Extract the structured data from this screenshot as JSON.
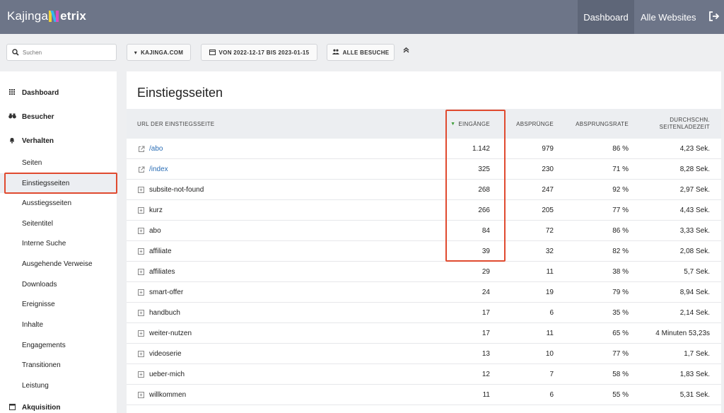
{
  "app": {
    "logo_prefix": "Kajinga",
    "logo_suffix": "etrix",
    "nav": {
      "dashboard": "Dashboard",
      "all_sites": "Alle Websites"
    }
  },
  "filters": {
    "search_placeholder": "Suchen",
    "site": "KAJINGA.COM",
    "date_range": "VON 2022-12-17 BIS 2023-01-15",
    "segment": "ALLE BESUCHE"
  },
  "sidebar": {
    "dashboard": "Dashboard",
    "visitors": "Besucher",
    "behavior": "Verhalten",
    "items": [
      "Seiten",
      "Einstiegsseiten",
      "Ausstiegsseiten",
      "Seitentitel",
      "Interne Suche",
      "Ausgehende Verweise",
      "Downloads",
      "Ereignisse",
      "Inhalte",
      "Engagements",
      "Transitionen",
      "Leistung"
    ],
    "acquisition": "Akquisition"
  },
  "report": {
    "title": "Einstiegsseiten",
    "columns": {
      "url": "URL DER EINSTIEGSSEITE",
      "entries": "EINGÄNGE",
      "bounces": "ABSPRÜNGE",
      "bounce_rate": "ABSPRUNGSRATE",
      "load_time_1": "DURCHSCHN.",
      "load_time_2": "SEITENLADEZEIT"
    },
    "rows": [
      {
        "url": "/abo",
        "type": "link",
        "entries": "1.142",
        "bounces": "979",
        "rate": "86 %",
        "time": "4,23 Sek."
      },
      {
        "url": "/index",
        "type": "link",
        "entries": "325",
        "bounces": "230",
        "rate": "71 %",
        "time": "8,28 Sek."
      },
      {
        "url": "subsite-not-found",
        "type": "group",
        "entries": "268",
        "bounces": "247",
        "rate": "92 %",
        "time": "2,97 Sek."
      },
      {
        "url": "kurz",
        "type": "group",
        "entries": "266",
        "bounces": "205",
        "rate": "77 %",
        "time": "4,43 Sek."
      },
      {
        "url": "abo",
        "type": "group",
        "entries": "84",
        "bounces": "72",
        "rate": "86 %",
        "time": "3,33 Sek."
      },
      {
        "url": "affiliate",
        "type": "group",
        "entries": "39",
        "bounces": "32",
        "rate": "82 %",
        "time": "2,08 Sek."
      },
      {
        "url": "affiliates",
        "type": "group",
        "entries": "29",
        "bounces": "11",
        "rate": "38 %",
        "time": "5,7 Sek."
      },
      {
        "url": "smart-offer",
        "type": "group",
        "entries": "24",
        "bounces": "19",
        "rate": "79 %",
        "time": "8,94 Sek."
      },
      {
        "url": "handbuch",
        "type": "group",
        "entries": "17",
        "bounces": "6",
        "rate": "35 %",
        "time": "2,14 Sek."
      },
      {
        "url": "weiter-nutzen",
        "type": "group",
        "entries": "17",
        "bounces": "11",
        "rate": "65 %",
        "time": "4 Minuten 53,23s"
      },
      {
        "url": "videoserie",
        "type": "group",
        "entries": "13",
        "bounces": "10",
        "rate": "77 %",
        "time": "1,7 Sek."
      },
      {
        "url": "ueber-mich",
        "type": "group",
        "entries": "12",
        "bounces": "7",
        "rate": "58 %",
        "time": "1,83 Sek."
      },
      {
        "url": "willkommen",
        "type": "group",
        "entries": "11",
        "bounces": "6",
        "rate": "55 %",
        "time": "5,31 Sek."
      }
    ]
  },
  "colors": {
    "topbar": "#6d7588",
    "highlight": "#e04a2f",
    "link": "#2a6db5",
    "sort_arrow": "#3f9e3a"
  }
}
